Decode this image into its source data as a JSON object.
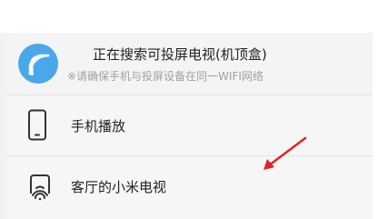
{
  "cast_panel": {
    "searching_title": "正在搜索可投屏电视(机顶盒)",
    "wifi_hint": "※请确保手机与投屏设备在同一WIFI网络",
    "cast_icon": "cast-signal-icon",
    "devices": [
      {
        "label": "手机播放",
        "icon": "phone-icon"
      },
      {
        "label": "客厅的小米电视",
        "icon": "tv-cast-icon"
      }
    ]
  },
  "colors": {
    "accent_blue": "#4aa8e8",
    "annotation_red": "#e02424"
  },
  "annotation": {
    "type": "red-arrow",
    "target": "客厅的小米电视"
  }
}
